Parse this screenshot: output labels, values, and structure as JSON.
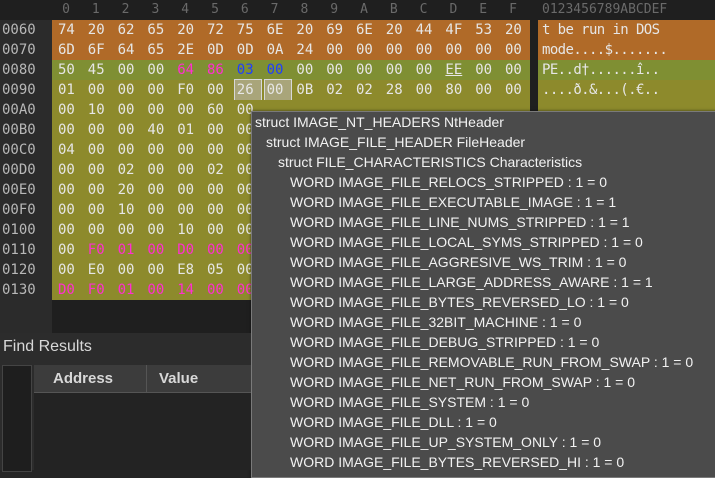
{
  "hex": {
    "columns": [
      "0",
      "1",
      "2",
      "3",
      "4",
      "5",
      "6",
      "7",
      "8",
      "9",
      "A",
      "B",
      "C",
      "D",
      "E",
      "F"
    ],
    "ascii_header": "0123456789ABCDEF",
    "rows": [
      {
        "offset": "0060",
        "bytes": [
          "74",
          "20",
          "62",
          "65",
          "20",
          "72",
          "75",
          "6E",
          "20",
          "69",
          "6E",
          "20",
          "44",
          "4F",
          "53",
          "20"
        ],
        "ascii": "t be run in DOS "
      },
      {
        "offset": "0070",
        "bytes": [
          "6D",
          "6F",
          "64",
          "65",
          "2E",
          "0D",
          "0D",
          "0A",
          "24",
          "00",
          "00",
          "00",
          "00",
          "00",
          "00",
          "00"
        ],
        "ascii": "mode....$......."
      },
      {
        "offset": "0080",
        "bytes": [
          "50",
          "45",
          "00",
          "00",
          "64",
          "86",
          "03",
          "00",
          "00",
          "00",
          "00",
          "00",
          "00",
          "EE",
          "00",
          "00"
        ],
        "ascii": "PE..d†......î.."
      },
      {
        "offset": "0090",
        "bytes": [
          "01",
          "00",
          "00",
          "00",
          "F0",
          "00",
          "26",
          "00",
          "0B",
          "02",
          "02",
          "28",
          "00",
          "80",
          "00",
          "00"
        ],
        "ascii": "....ð.&...(.€.."
      },
      {
        "offset": "00A0",
        "bytes": [
          "00",
          "10",
          "00",
          "00",
          "00",
          "60",
          "00",
          "",
          "",
          "",
          "",
          "",
          "",
          "",
          "",
          ""
        ],
        "ascii": ""
      },
      {
        "offset": "00B0",
        "bytes": [
          "00",
          "00",
          "00",
          "40",
          "01",
          "00",
          "00",
          "",
          "",
          "",
          "",
          "",
          "",
          "",
          "",
          ""
        ],
        "ascii": ""
      },
      {
        "offset": "00C0",
        "bytes": [
          "04",
          "00",
          "00",
          "00",
          "00",
          "00",
          "00",
          "",
          "",
          "",
          "",
          "",
          "",
          "",
          "",
          ""
        ],
        "ascii": ""
      },
      {
        "offset": "00D0",
        "bytes": [
          "00",
          "00",
          "02",
          "00",
          "00",
          "02",
          "00",
          "",
          "",
          "",
          "",
          "",
          "",
          "",
          "",
          ""
        ],
        "ascii": ""
      },
      {
        "offset": "00E0",
        "bytes": [
          "00",
          "00",
          "20",
          "00",
          "00",
          "00",
          "00",
          "",
          "",
          "",
          "",
          "",
          "",
          "",
          "",
          ""
        ],
        "ascii": ""
      },
      {
        "offset": "00F0",
        "bytes": [
          "00",
          "00",
          "10",
          "00",
          "00",
          "00",
          "00",
          "",
          "",
          "",
          "",
          "",
          "",
          "",
          "",
          ""
        ],
        "ascii": ""
      },
      {
        "offset": "0100",
        "bytes": [
          "00",
          "00",
          "00",
          "00",
          "10",
          "00",
          "00",
          "",
          "",
          "",
          "",
          "",
          "",
          "",
          "",
          ""
        ],
        "ascii": ""
      },
      {
        "offset": "0110",
        "bytes": [
          "00",
          "F0",
          "01",
          "00",
          "D0",
          "00",
          "00",
          "",
          "",
          "",
          "",
          "",
          "",
          "",
          "",
          ""
        ],
        "ascii": ""
      },
      {
        "offset": "0120",
        "bytes": [
          "00",
          "E0",
          "00",
          "00",
          "E8",
          "05",
          "00",
          "",
          "",
          "",
          "",
          "",
          "",
          "",
          "",
          ""
        ],
        "ascii": ""
      },
      {
        "offset": "0130",
        "bytes": [
          "D0",
          "F0",
          "01",
          "00",
          "14",
          "00",
          "00",
          "",
          "",
          "",
          "",
          "",
          "",
          "",
          "",
          ""
        ],
        "ascii": ""
      }
    ],
    "colors": {
      "orange": "#b06a28",
      "green": "#7f8f33",
      "olive": "#8d8a2c",
      "magenta": "#ff2fd0",
      "blue": "#1f3fff",
      "text": "#e6e6e6"
    }
  },
  "struct_popup": {
    "lines": [
      {
        "indent": 0,
        "text": "struct IMAGE_NT_HEADERS NtHeader"
      },
      {
        "indent": 1,
        "text": "struct IMAGE_FILE_HEADER FileHeader"
      },
      {
        "indent": 2,
        "text": "struct FILE_CHARACTERISTICS Characteristics"
      },
      {
        "indent": 3,
        "text": "WORD IMAGE_FILE_RELOCS_STRIPPED : 1 = 0"
      },
      {
        "indent": 3,
        "text": "WORD IMAGE_FILE_EXECUTABLE_IMAGE : 1 = 1"
      },
      {
        "indent": 3,
        "text": "WORD IMAGE_FILE_LINE_NUMS_STRIPPED : 1 = 1"
      },
      {
        "indent": 3,
        "text": "WORD IMAGE_FILE_LOCAL_SYMS_STRIPPED : 1 = 0"
      },
      {
        "indent": 3,
        "text": "WORD IMAGE_FILE_AGGRESIVE_WS_TRIM : 1 = 0"
      },
      {
        "indent": 3,
        "text": "WORD IMAGE_FILE_LARGE_ADDRESS_AWARE : 1 = 1"
      },
      {
        "indent": 3,
        "text": "WORD IMAGE_FILE_BYTES_REVERSED_LO : 1 = 0"
      },
      {
        "indent": 3,
        "text": "WORD IMAGE_FILE_32BIT_MACHINE : 1 = 0"
      },
      {
        "indent": 3,
        "text": "WORD IMAGE_FILE_DEBUG_STRIPPED : 1 = 0"
      },
      {
        "indent": 3,
        "text": "WORD IMAGE_FILE_REMOVABLE_RUN_FROM_SWAP : 1 = 0"
      },
      {
        "indent": 3,
        "text": "WORD IMAGE_FILE_NET_RUN_FROM_SWAP : 1 = 0"
      },
      {
        "indent": 3,
        "text": "WORD IMAGE_FILE_SYSTEM : 1 = 0"
      },
      {
        "indent": 3,
        "text": "WORD IMAGE_FILE_DLL : 1 = 0"
      },
      {
        "indent": 3,
        "text": "WORD IMAGE_FILE_UP_SYSTEM_ONLY : 1 = 0"
      },
      {
        "indent": 3,
        "text": "WORD IMAGE_FILE_BYTES_REVERSED_HI : 1 = 0"
      }
    ]
  },
  "find_results": {
    "title": "Find Results",
    "columns": [
      "Address",
      "Value"
    ]
  }
}
